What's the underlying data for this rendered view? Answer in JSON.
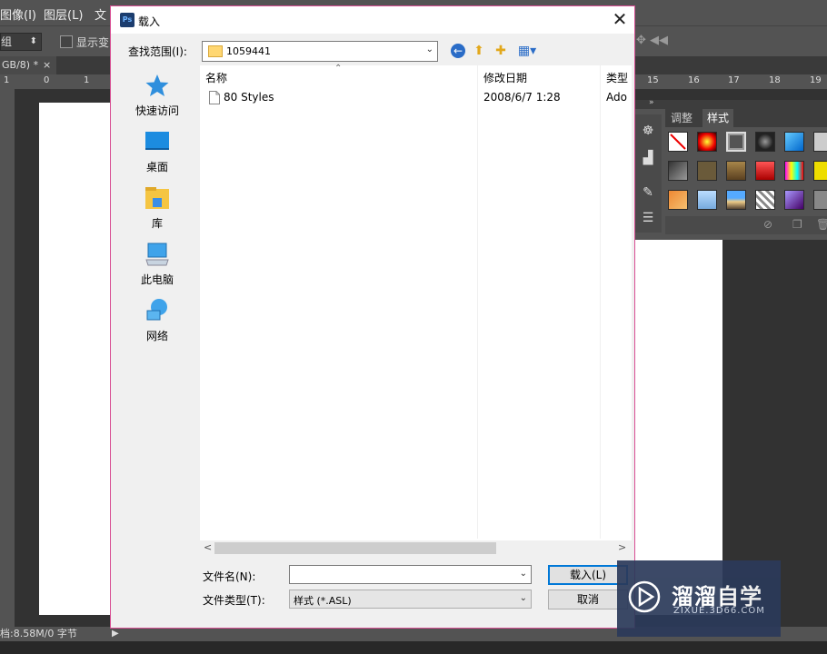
{
  "ps": {
    "menu": [
      "图像(I)",
      "图层(L)",
      "文"
    ],
    "option_combo": "组",
    "option_checkbox": "显示变",
    "doc_tab": "GB/8) *",
    "doc_tab_close": "×",
    "ruler_left": [
      "1",
      "0",
      "1"
    ],
    "ruler_right": [
      "15",
      "16",
      "17",
      "18",
      "19"
    ],
    "status": "档:8.58M/0 字节",
    "panel_tabs": [
      "调整",
      "样式"
    ],
    "panel_collapse": "»"
  },
  "dialog": {
    "title": "载入",
    "title_icon": "Ps",
    "close": "✕",
    "lookin_label": "查找范围(I):",
    "lookin_value": "1059441",
    "sidebar": [
      {
        "label": "快速访问",
        "icon": "star-icon"
      },
      {
        "label": "桌面",
        "icon": "desktop-icon"
      },
      {
        "label": "库",
        "icon": "library-icon"
      },
      {
        "label": "此电脑",
        "icon": "computer-icon"
      },
      {
        "label": "网络",
        "icon": "network-icon"
      }
    ],
    "columns": {
      "name": "名称",
      "date": "修改日期",
      "type": "类型"
    },
    "files": [
      {
        "name": "80 Styles",
        "date": "2008/6/7 1:28",
        "type": "Ado"
      }
    ],
    "filename_label": "文件名(N):",
    "filename_value": "",
    "filetype_label": "文件类型(T):",
    "filetype_value": "样式 (*.ASL)",
    "load_button": "载入(L)",
    "cancel_button": "取消"
  },
  "watermark": {
    "brand": "溜溜自学",
    "url": "ZIXUE.3D66.COM"
  }
}
